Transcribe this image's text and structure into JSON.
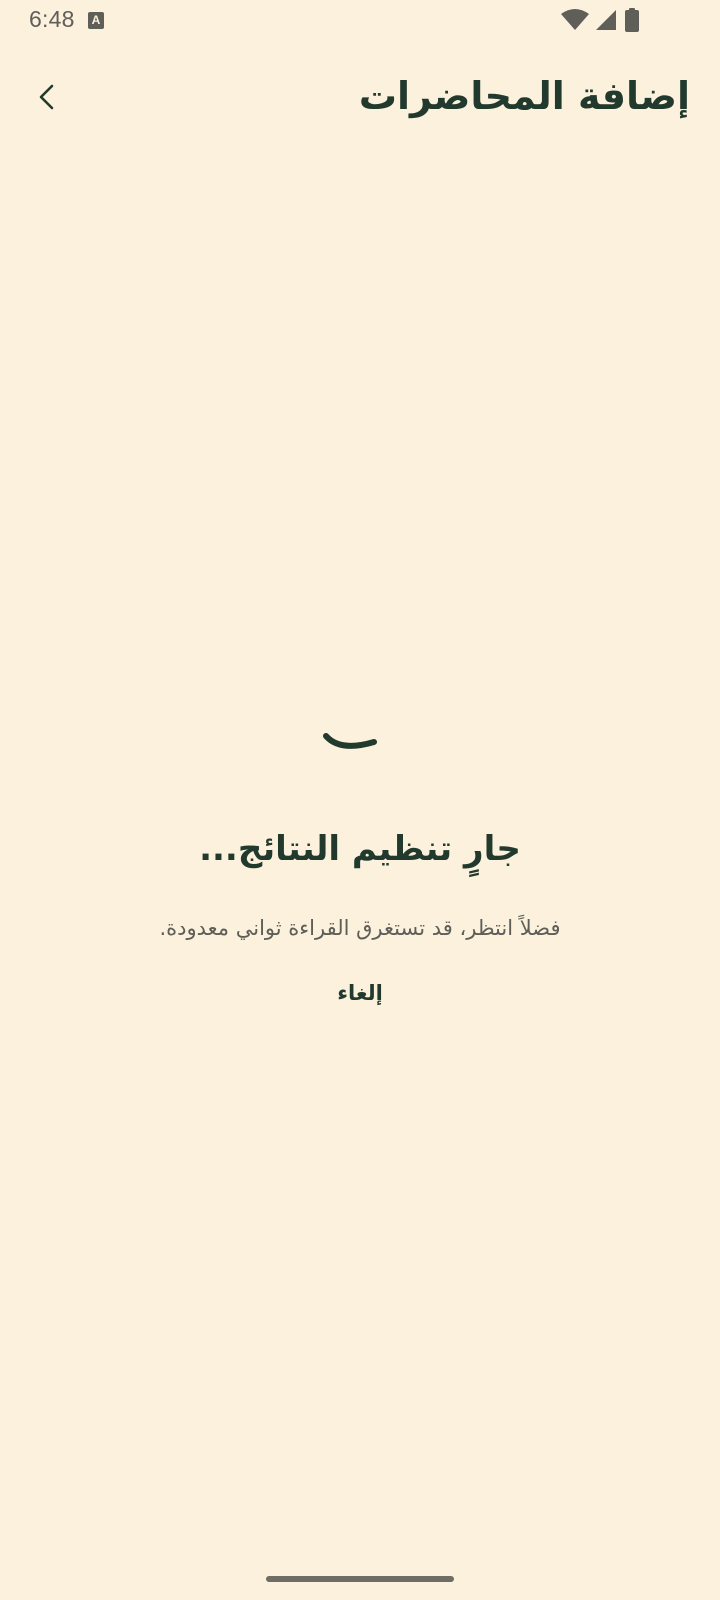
{
  "status_bar": {
    "time": "6:48",
    "notification_icon": "A",
    "icons": [
      "wifi-icon",
      "cellular-signal-icon",
      "battery-icon"
    ]
  },
  "app_bar": {
    "title": "إضافة المحاضرات",
    "back_icon": "chevron-left-icon"
  },
  "loading": {
    "title": "جارٍ تنظيم النتائج...",
    "subtitle": "فضلاً انتظر، قد تستغرق القراءة ثواني معدودة.",
    "cancel_label": "إلغاء",
    "spinner_icon": "progress-spinner-icon"
  },
  "colors": {
    "background": "#FBF1DD",
    "primary_text": "#22392D",
    "secondary_text": "#5E5E58",
    "status_icons": "#5F5E58"
  }
}
